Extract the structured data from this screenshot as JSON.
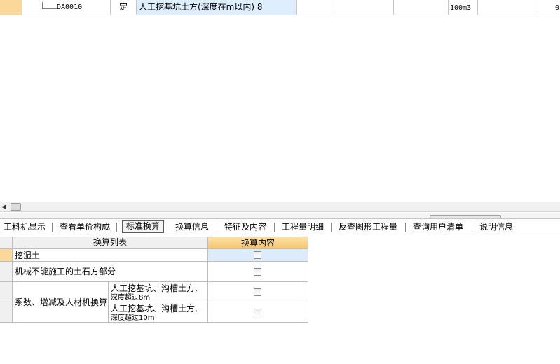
{
  "row": {
    "code": "DA0010",
    "type": "定",
    "name": "人工挖基坑土方(深度在m以内) 8",
    "unit": "100m3",
    "tail": "0"
  },
  "tabs": [
    {
      "label": "工料机显示"
    },
    {
      "label": "查看单价构成"
    },
    {
      "label": "标准换算"
    },
    {
      "label": "换算信息"
    },
    {
      "label": "特征及内容"
    },
    {
      "label": "工程量明细"
    },
    {
      "label": "反查图形工程量"
    },
    {
      "label": "查询用户清单"
    },
    {
      "label": "说明信息"
    }
  ],
  "active_tab": "标准换算",
  "conversion": {
    "col_list": "换算列表",
    "col_content": "换算内容",
    "rows": [
      {
        "label": "挖湿土",
        "checked": false
      },
      {
        "label": "机械不能施工的土石方部分",
        "checked": false
      },
      {
        "label": "人工挖基坑、沟槽土方,",
        "label2": "深度超过8m",
        "checked": false
      },
      {
        "label": "人工挖基坑、沟槽土方,",
        "label2": "深度超过10m",
        "checked": false
      }
    ],
    "group_label": "系数、增减及人材机换算"
  }
}
